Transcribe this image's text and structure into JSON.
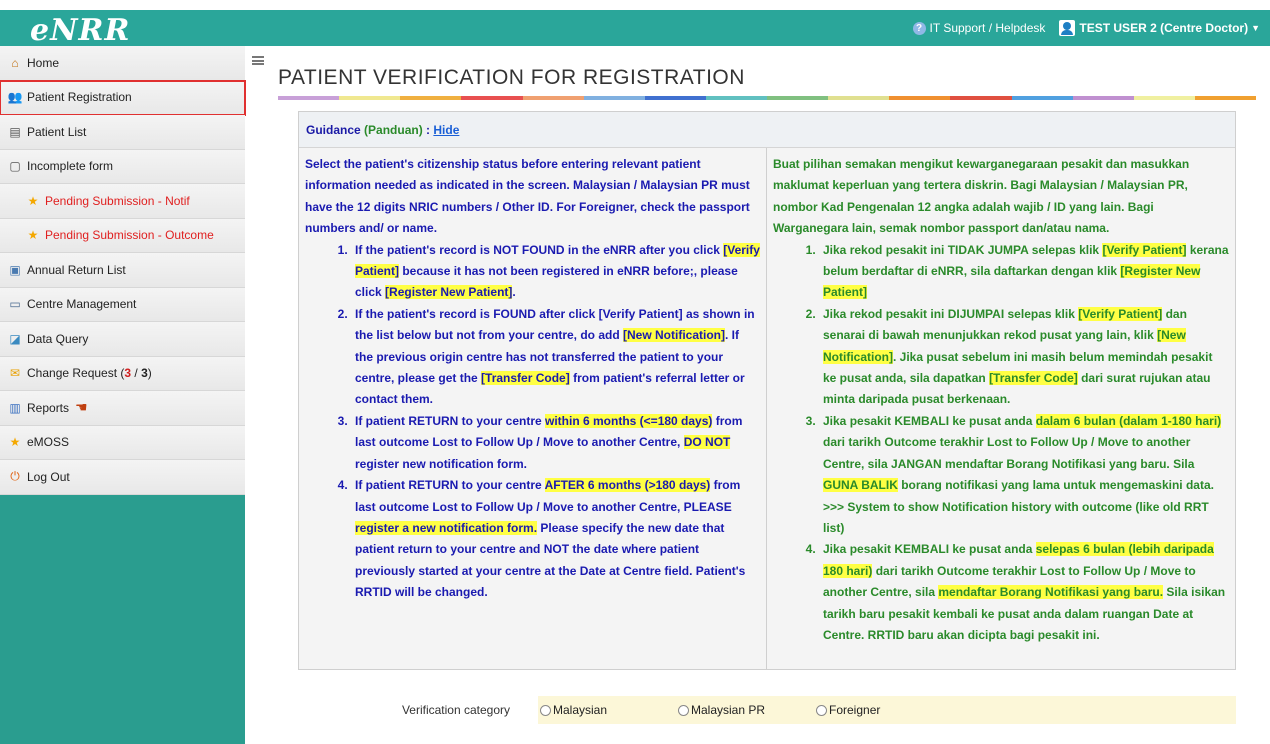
{
  "app": {
    "logo": "eNRR",
    "helpdesk": "IT Support / Helpdesk",
    "user": "TEST USER 2 (Centre Doctor)"
  },
  "colors": {
    "topbar": "#2aa69a",
    "sidebar": "#2a9d8f",
    "english_text": "#1a1ab0",
    "malay_text": "#2a8a2a",
    "highlight": "#ffff44",
    "active_border": "#e03030"
  },
  "menu": {
    "home": "Home",
    "patient_registration": "Patient Registration",
    "patient_list": "Patient List",
    "incomplete_form": "Incomplete form",
    "pending_notif": "Pending Submission - Notif",
    "pending_outcome": "Pending Submission - Outcome",
    "annual_return": "Annual Return List",
    "centre_management": "Centre Management",
    "data_query": "Data Query",
    "change_request": "Change Request (",
    "change_request_a": "3",
    "change_request_sep": " / ",
    "change_request_b": "3",
    "change_request_end": ")",
    "reports": "Reports",
    "emoss": "eMOSS",
    "logout": "Log Out"
  },
  "page": {
    "title": "PATIENT VERIFICATION FOR REGISTRATION"
  },
  "guidance": {
    "label_en": "Guidance",
    "label_ms": "(Panduan)",
    "colon": " : ",
    "hide": "Hide",
    "en_intro": "Select the patient's citizenship status before entering relevant patient information needed as indicated in the screen. Malaysian / Malaysian PR must have the 12 digits NRIC numbers / Other ID. For Foreigner, check the passport numbers and/ or name.",
    "en_1a": "If the patient's record is NOT FOUND in the eNRR after you click ",
    "en_1b": "[Verify Patient]",
    "en_1c": " because it has not been registered in eNRR before;, please click ",
    "en_1d": "[Register New Patient]",
    "en_1e": ".",
    "en_2a": "If the patient's record is FOUND after click [Verify Patient] as shown in the list below but not from your centre, do add ",
    "en_2b": "[New Notification]",
    "en_2c": ". If the previous origin centre has not transferred the patient to your centre, please get the ",
    "en_2d": "[Transfer Code]",
    "en_2e": " from patient's referral letter or contact them.",
    "en_3a": "If patient RETURN to your centre ",
    "en_3b": "within 6 months (<=180 days)",
    "en_3c": " from last outcome Lost to Follow Up / Move to another Centre, ",
    "en_3d": "DO NOT",
    "en_3e": " register new notification form.",
    "en_4a": "If patient RETURN to your centre ",
    "en_4b": "AFTER 6 months (>180 days)",
    "en_4c": " from last outcome Lost to Follow Up / Move to another Centre, PLEASE ",
    "en_4d": "register a new notification form.",
    "en_4e": " Please specify the new date that patient return to your centre and NOT the date where patient previously started at your centre at the Date at Centre field. Patient's RRTID will be changed.",
    "ms_intro": "Buat pilihan semakan mengikut kewarganegaraan pesakit dan masukkan maklumat keperluan yang tertera diskrin. Bagi Malaysian / Malaysian PR, nombor Kad Pengenalan 12 angka adalah wajib / ID yang lain. Bagi Warganegara lain, semak nombor passport dan/atau nama.",
    "ms_1a": "Jika rekod pesakit ini TIDAK JUMPA selepas klik ",
    "ms_1b": "[Verify Patient]",
    "ms_1c": " kerana belum berdaftar di eNRR, sila daftarkan dengan klik ",
    "ms_1d": "[Register New Patient]",
    "ms_2a": "Jika rekod pesakit ini DIJUMPAI selepas klik ",
    "ms_2b": "[Verify Patient]",
    "ms_2c": " dan senarai di bawah menunjukkan rekod pusat yang lain, klik ",
    "ms_2d": "[New Notification]",
    "ms_2e": ". Jika pusat sebelum ini masih belum memindah pesakit ke pusat anda, sila dapatkan ",
    "ms_2f": "[Transfer Code]",
    "ms_2g": " dari surat rujukan atau minta daripada pusat berkenaan.",
    "ms_3a": "Jika pesakit KEMBALI ke pusat anda ",
    "ms_3b": "dalam 6 bulan (dalam 1-180 hari)",
    "ms_3c": " dari tarikh Outcome terakhir Lost to Follow Up / Move to another Centre, sila JANGAN mendaftar Borang Notifikasi yang baru. Sila ",
    "ms_3d": "GUNA BALIK",
    "ms_3e": " borang notifikasi yang lama untuk mengemaskini data. >>> System to show Notification history with outcome (like old RRT list)",
    "ms_4a": "Jika pesakit KEMBALI ke pusat anda ",
    "ms_4b": "selepas 6 bulan (lebih daripada 180 hari)",
    "ms_4c": " dari tarikh Outcome terakhir Lost to Follow Up / Move to another Centre, sila ",
    "ms_4d": "mendaftar Borang Notifikasi yang baru.",
    "ms_4e": " Sila isikan tarikh baru pesakit kembali ke pusat anda dalam ruangan Date at Centre. RRTID baru akan dicipta bagi pesakit ini."
  },
  "verification": {
    "label": "Verification category",
    "options": [
      "Malaysian",
      "Malaysian PR",
      "Foreigner"
    ]
  }
}
